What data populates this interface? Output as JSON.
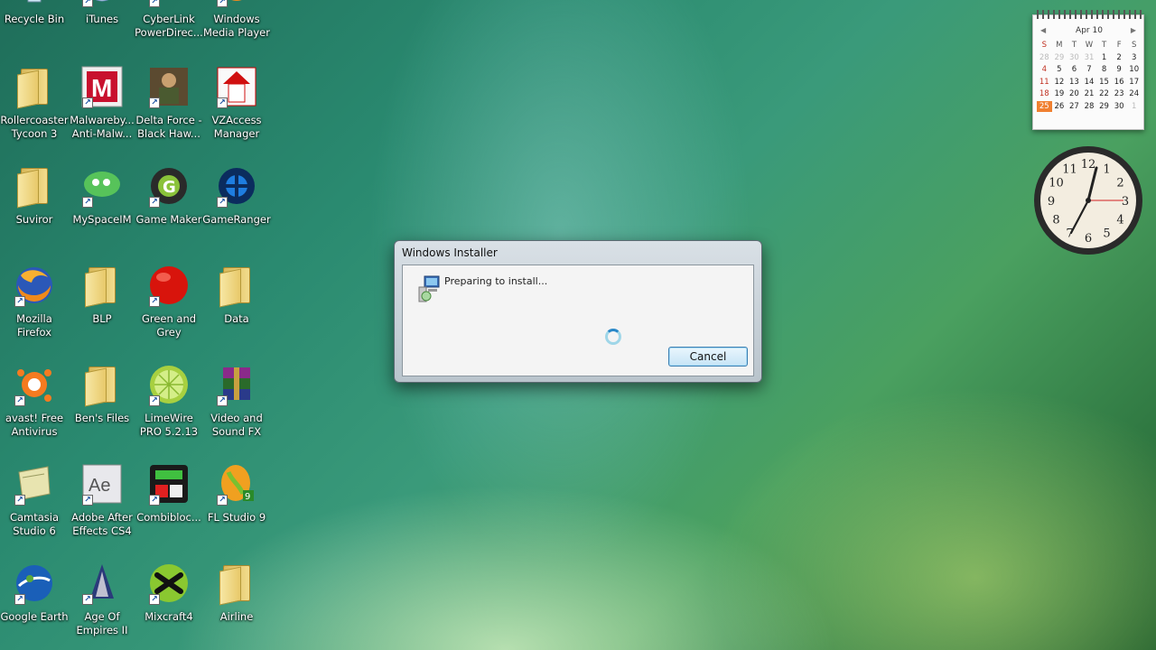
{
  "desktop_icons": [
    {
      "label": "Recycle Bin",
      "icon": "recycle-bin-icon"
    },
    {
      "label": "iTunes",
      "icon": "itunes-icon"
    },
    {
      "label": "CyberLink PowerDirec...",
      "icon": "cyberlink-icon"
    },
    {
      "label": "Windows Media Player",
      "icon": "media-player-icon"
    },
    {
      "label": "Rollercoaster Tycoon 3",
      "icon": "folder-icon"
    },
    {
      "label": "Malwareby... Anti-Malw...",
      "icon": "malwarebytes-icon"
    },
    {
      "label": "Delta Force - Black Haw...",
      "icon": "delta-force-icon"
    },
    {
      "label": "VZAccess Manager",
      "icon": "vzaccess-icon"
    },
    {
      "label": "Suviror",
      "icon": "folder-icon"
    },
    {
      "label": "MySpaceIM",
      "icon": "myspaceim-icon"
    },
    {
      "label": "Game Maker",
      "icon": "game-maker-icon"
    },
    {
      "label": "GameRanger",
      "icon": "gameranger-icon"
    },
    {
      "label": "Mozilla Firefox",
      "icon": "firefox-icon"
    },
    {
      "label": "BLP",
      "icon": "folder-icon"
    },
    {
      "label": "Green and Grey",
      "icon": "red-ball-icon"
    },
    {
      "label": "Data",
      "icon": "folder-icon"
    },
    {
      "label": "avast! Free Antivirus",
      "icon": "avast-icon"
    },
    {
      "label": "Ben's Files",
      "icon": "folder-icon"
    },
    {
      "label": "LimeWire PRO 5.2.13",
      "icon": "limewire-icon"
    },
    {
      "label": "Video and Sound FX",
      "icon": "winrar-icon"
    },
    {
      "label": "Camtasia Studio 6",
      "icon": "camtasia-icon"
    },
    {
      "label": "Adobe After Effects CS4",
      "icon": "after-effects-icon"
    },
    {
      "label": "Combibloc...",
      "icon": "combibloc-icon"
    },
    {
      "label": "FL Studio 9",
      "icon": "fl-studio-icon"
    },
    {
      "label": "Google Earth",
      "icon": "google-earth-icon"
    },
    {
      "label": "Age Of Empires II",
      "icon": "age-of-empires-icon"
    },
    {
      "label": "Mixcraft4",
      "icon": "mixcraft-icon"
    },
    {
      "label": "Airline",
      "icon": "folder-icon"
    }
  ],
  "dialog": {
    "title": "Windows Installer",
    "message": "Preparing to install...",
    "cancel_label": "Cancel"
  },
  "calendar": {
    "month_label": "Apr 10",
    "prev": "◀",
    "next": "▶",
    "weekdays": [
      "S",
      "M",
      "T",
      "W",
      "T",
      "F",
      "S"
    ],
    "weeks": [
      [
        "28",
        "29",
        "30",
        "31",
        "1",
        "2",
        "3"
      ],
      [
        "4",
        "5",
        "6",
        "7",
        "8",
        "9",
        "10"
      ],
      [
        "11",
        "12",
        "13",
        "14",
        "15",
        "16",
        "17"
      ],
      [
        "18",
        "19",
        "20",
        "21",
        "22",
        "23",
        "24"
      ],
      [
        "25",
        "26",
        "27",
        "28",
        "29",
        "30",
        "1"
      ]
    ],
    "today": "25"
  },
  "clock": {
    "numerals": [
      "12",
      "1",
      "2",
      "3",
      "4",
      "5",
      "6",
      "7",
      "8",
      "9",
      "10",
      "11"
    ]
  },
  "colors": {
    "desktop_accent": "#2a8a70",
    "button_border": "#3c7fb1",
    "today_highlight": "#f08030"
  }
}
